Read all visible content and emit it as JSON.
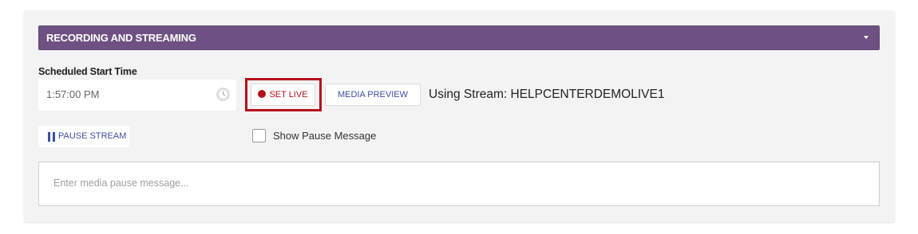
{
  "section": {
    "title": "RECORDING AND STREAMING",
    "accent_color": "#6e5182",
    "toggle_icon": "caret-down-icon"
  },
  "schedule": {
    "label": "Scheduled Start Time",
    "time_value": "1:57:00 PM",
    "icon": "clock-icon"
  },
  "controls": {
    "set_live_label": "SET LIVE",
    "set_live_color": "#b5121b",
    "media_preview_label": "MEDIA PREVIEW",
    "stream_text": "Using Stream: HELPCENTERDEMOLIVE1",
    "pause_stream_label": "PAUSE STREAM",
    "pause_icon": "pause-icon"
  },
  "pause": {
    "show_message_label": "Show Pause Message",
    "show_message_checked": false,
    "message_placeholder": "Enter media pause message..."
  }
}
